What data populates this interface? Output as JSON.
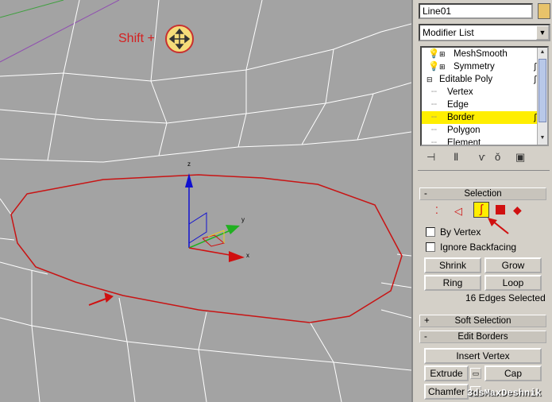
{
  "viewport": {
    "shift_label": "Shift +",
    "axis_z": "z",
    "axis_y": "y",
    "axis_x": "x",
    "colors": {
      "border_edge": "#c81414",
      "wire": "#ffffff",
      "axis_z": "#1010d0",
      "axis_y": "#20b020",
      "axis_x": "#d01010",
      "highlight": "#f5dc7a"
    }
  },
  "panel": {
    "object_name": "Line01",
    "modifier_list": "Modifier List",
    "stack": [
      {
        "label": "MeshSmooth"
      },
      {
        "label": "Symmetry"
      },
      {
        "label": "Editable Poly"
      },
      {
        "label": "Vertex"
      },
      {
        "label": "Edge"
      },
      {
        "label": "Border"
      },
      {
        "label": "Polygon"
      },
      {
        "label": "Element"
      }
    ],
    "selection": {
      "header": "Selection",
      "header_sign": "-",
      "by_vertex": "By Vertex",
      "ignore_backfacing": "Ignore Backfacing",
      "shrink": "Shrink",
      "grow": "Grow",
      "ring": "Ring",
      "loop": "Loop",
      "info": "16 Edges Selected"
    },
    "soft_selection": {
      "header": "Soft Selection",
      "header_sign": "+"
    },
    "edit_borders": {
      "header": "Edit Borders",
      "header_sign": "-",
      "insert_vertex": "Insert Vertex",
      "extrude": "Extrude",
      "cap": "Cap",
      "chamfer": "Chamfer"
    },
    "accent_color": "#ffee00"
  },
  "watermark": "3dsMaxDeshnik"
}
